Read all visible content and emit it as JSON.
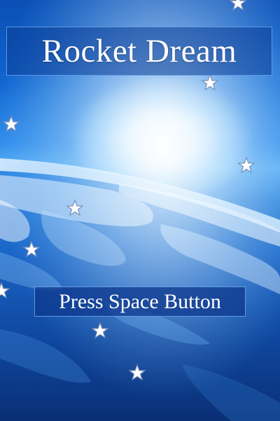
{
  "game": {
    "title": "Rocket Dream",
    "start_prompt": "Press Space Button"
  },
  "colors": {
    "background_deep": "#0a3a8c",
    "panel_border": "#6eaaf0",
    "text": "#ffffff"
  },
  "icons": {
    "star": "star-icon"
  }
}
